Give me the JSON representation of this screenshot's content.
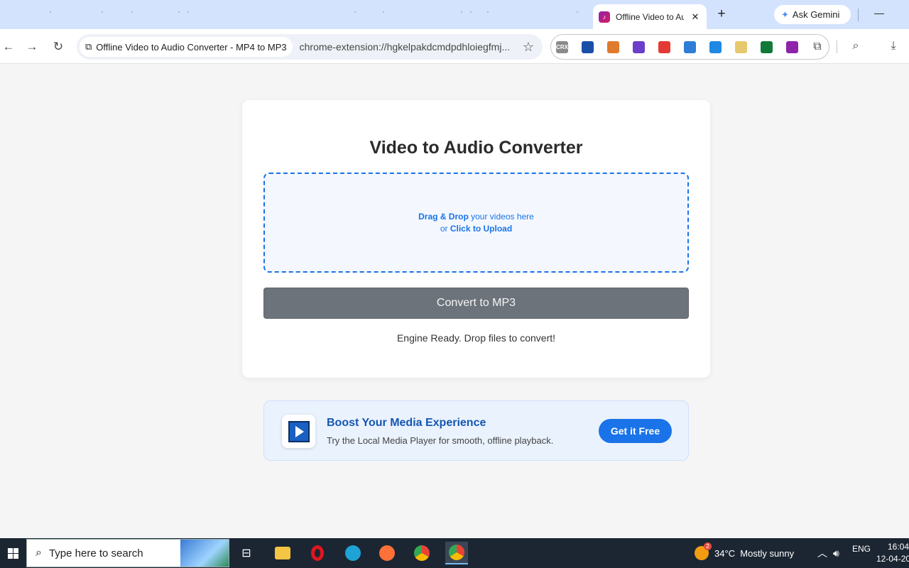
{
  "browser": {
    "tab_title": "Offline Video to Audio Converter - MP4 to MP3",
    "new_tab_symbol": "+",
    "gemini_label": "Ask Gemini",
    "site_chip": "Offline Video to Audio Converter - MP4 to MP3",
    "url": "chrome-extension://hgkelpakdcmdpdhloiegfmj...",
    "extensions": [
      {
        "icon": "crx-icon",
        "label": "CRX",
        "color": "#8a8a8a"
      },
      {
        "icon": "video-ext-icon",
        "color": "#1a4fa8"
      },
      {
        "icon": "cake-ext-icon",
        "color": "#e07a2e"
      },
      {
        "icon": "music-ext-icon",
        "color": "#6b3fc9"
      },
      {
        "icon": "tomato-ext-icon",
        "color": "#e53935"
      },
      {
        "icon": "puzzle-color-ext-icon",
        "color": "#2e7dd7"
      },
      {
        "icon": "search-ext-icon",
        "color": "#1e88e5"
      },
      {
        "icon": "note-ext-icon",
        "color": "#e6c86e"
      },
      {
        "icon": "circle-ext-icon",
        "color": "#117a3a"
      },
      {
        "icon": "converter-ext-icon",
        "color": "#8e24aa"
      }
    ]
  },
  "page": {
    "title": "Video to Audio Converter",
    "dropzone": {
      "line1_bold": "Drag & Drop",
      "line1_rest": " your videos here",
      "line2_pre": "or ",
      "line2_bold": "Click to Upload"
    },
    "convert_button": "Convert to MP3",
    "status": "Engine Ready. Drop files to convert!"
  },
  "promo": {
    "title": "Boost Your Media Experience",
    "subtitle": "Try the Local Media Player for smooth, offline playback.",
    "button": "Get it Free"
  },
  "taskbar": {
    "search_placeholder": "Type here to search",
    "apps": [
      {
        "icon": "task-view-icon"
      },
      {
        "icon": "file-explorer-icon",
        "color": "#f4c542"
      },
      {
        "icon": "opera-icon",
        "color": "#e0161f"
      },
      {
        "icon": "edge-icon",
        "color": "#1fa2d6"
      },
      {
        "icon": "firefox-icon",
        "color": "#ff7139"
      },
      {
        "icon": "chrome-icon",
        "color": "#34a853"
      },
      {
        "icon": "chrome-active-icon",
        "color": "#34a853",
        "active": true
      }
    ],
    "weather_badge": "2",
    "weather": "34°C  Mostly sunny",
    "language": "ENG",
    "time": "16:04",
    "date": "12-04-20"
  }
}
